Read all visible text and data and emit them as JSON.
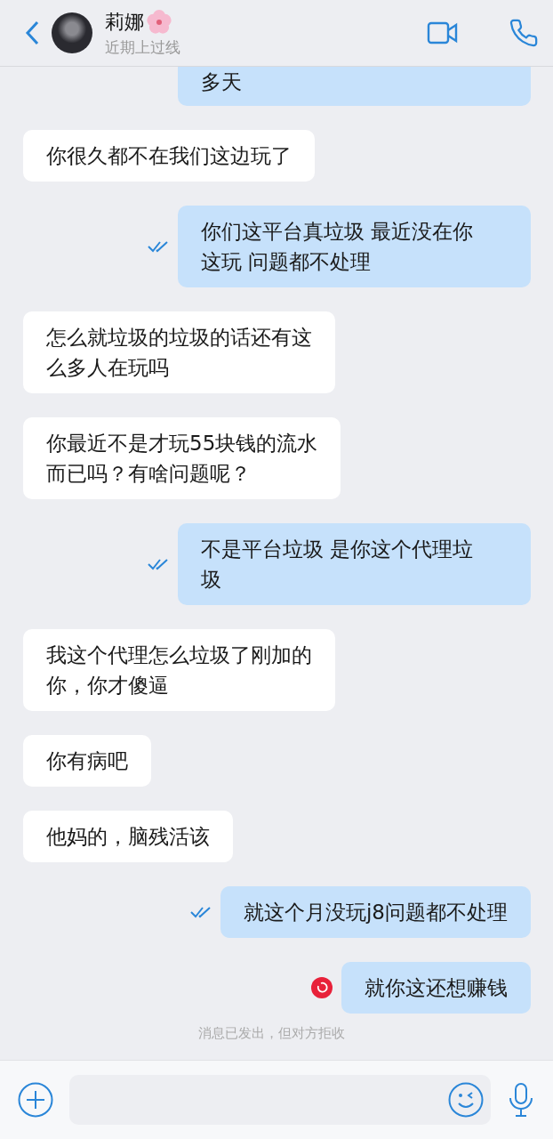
{
  "header": {
    "name": "莉娜",
    "status": "近期上过线"
  },
  "messages": [
    {
      "kind": "outgoing",
      "lines": [
        "多天"
      ],
      "read": false,
      "failed": false,
      "partial": true
    },
    {
      "kind": "incoming",
      "lines": [
        "你很久都不在我们这边玩了"
      ]
    },
    {
      "kind": "outgoing",
      "lines": [
        "你们这平台真垃圾 最近没在你",
        "这玩 问题都不处理"
      ],
      "read": true,
      "failed": false
    },
    {
      "kind": "incoming",
      "lines": [
        "怎么就垃圾的垃圾的话还有这",
        "么多人在玩吗"
      ]
    },
    {
      "kind": "incoming",
      "lines": [
        "你最近不是才玩55块钱的流水",
        "而已吗？有啥问题呢？"
      ]
    },
    {
      "kind": "outgoing",
      "lines": [
        "不是平台垃圾 是你这个代理垃",
        "圾"
      ],
      "read": true,
      "failed": false
    },
    {
      "kind": "incoming",
      "lines": [
        "我这个代理怎么垃圾了刚加的",
        "你，你才傻逼"
      ]
    },
    {
      "kind": "incoming",
      "lines": [
        "你有病吧"
      ]
    },
    {
      "kind": "incoming",
      "lines": [
        "他妈的，脑残活该"
      ]
    },
    {
      "kind": "outgoing",
      "lines": [
        "就这个月没玩j8问题都不处理"
      ],
      "read": true,
      "failed": false
    },
    {
      "kind": "outgoing",
      "lines": [
        "就你这还想赚钱"
      ],
      "read": false,
      "failed": true
    }
  ],
  "notice": "消息已发出，但对方拒收"
}
